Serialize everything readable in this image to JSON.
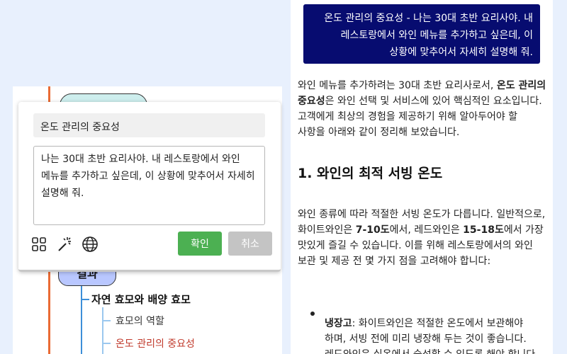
{
  "mindmap": {
    "node_bottom_label": "결과",
    "branch_1": "자연 효모와 배양 효모",
    "branch_2": "효모의 역할",
    "branch_3": "온도 관리의 중요성"
  },
  "popup": {
    "title_value": "온도 관리의 중요성",
    "prompt_text": "나는 30대 초반 요리사야. 내 레스토랑에서 와인 메뉴를 추가하고 싶은데, 이 상황에 맞추어서 자세히 설명해 줘.",
    "icons": [
      "grid-icon",
      "magic-wand-icon",
      "globe-icon"
    ],
    "confirm_label": "확인",
    "cancel_label": "취소",
    "confirm_color": "#4cb052",
    "cancel_color": "#c4c4c4"
  },
  "chat": {
    "user_message": "온도 관리의 중요성 - 나는 30대 초반 요리사야. 내 레스토랑에서 와인 메뉴를 추가하고 싶은데, 이 상황에 맞추어서 자세히 설명해 줘.",
    "user_bubble_color": "#070c70",
    "p1_before": "와인 메뉴를 추가하려는 30대 초반 요리사로서, ",
    "p1_bold": "온도 관리의 중요성",
    "p1_after": "은 와인 선택 및 서비스에 있어 핵심적인 요소입니다. 고객에게 최상의 경험을 제공하기 위해 알아두어야 할 사항을 아래와 같이 정리해 보았습니다.",
    "heading": "1. 와인의 최적 서빙 온도",
    "p2_a": "와인 종류에 따라 적절한 서빙 온도가 다릅니다. 일반적으로, 화이트와인은 ",
    "p2_bold1": "7-10도",
    "p2_b": "에서, 레드와인은 ",
    "p2_bold2": "15-18도",
    "p2_c": "에서 가장 맛있게 즐길 수 있습니다. 이를 위해 레스토랑에서의 와인 보관 및 제공 전 몇 가지 점을 고려해야 합니다:",
    "bullet_bold": "냉장고",
    "bullet_text": ": 화이트와인은 적절한 온도에서 보관해야 하며, 서빙 전에 미리 냉장해 두는 것이 좋습니다. 레드와인은 실온에서 숙성할 수 있도록 해야 합니다."
  }
}
